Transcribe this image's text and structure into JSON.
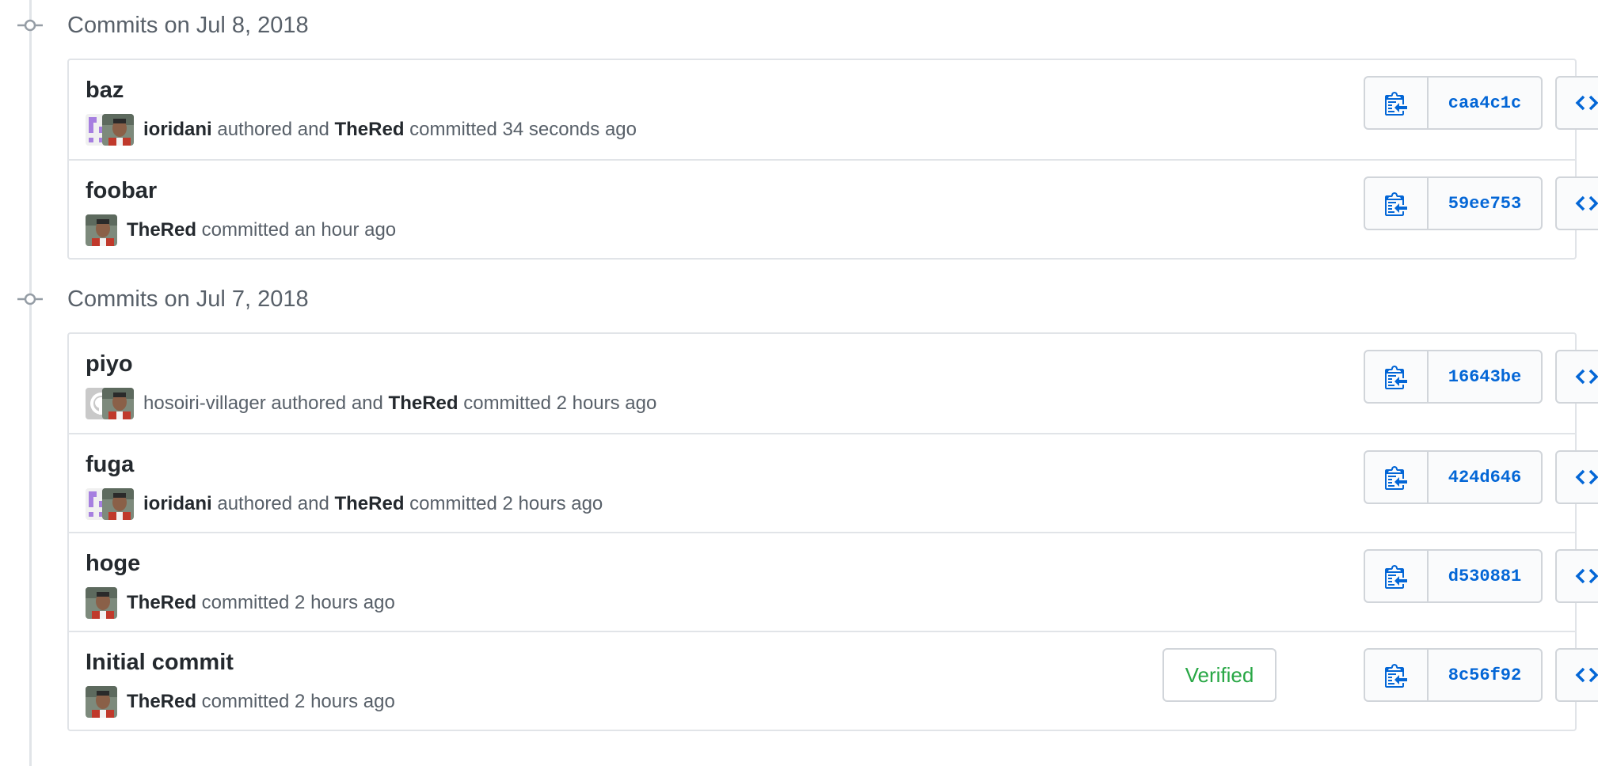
{
  "colors": {
    "accent": "#0366d6",
    "verified": "#28a745",
    "muted": "#586069",
    "border": "#e1e4e8"
  },
  "groups": [
    {
      "title": "Commits on Jul 8, 2018",
      "commits": [
        {
          "title": "baz",
          "author": "ioridani",
          "authored_text": " authored and ",
          "committer": "TheRed",
          "committed_text": " committed 34 seconds ago",
          "sha": "caa4c1c",
          "avatars": [
            "identicon-purple",
            "thered-photo"
          ]
        },
        {
          "title": "foobar",
          "committer": "TheRed",
          "committed_text": " committed an hour ago",
          "sha": "59ee753",
          "avatars": [
            "thered-photo"
          ]
        }
      ]
    },
    {
      "title": "Commits on Jul 7, 2018",
      "commits": [
        {
          "title": "piyo",
          "author": "hosoiri-villager",
          "authored_text": " authored and ",
          "committer": "TheRed",
          "committed_text": " committed 2 hours ago",
          "sha": "16643be",
          "avatars": [
            "github-default",
            "thered-photo"
          ]
        },
        {
          "title": "fuga",
          "author": "ioridani",
          "authored_text": " authored and ",
          "committer": "TheRed",
          "committed_text": " committed 2 hours ago",
          "sha": "424d646",
          "avatars": [
            "identicon-purple",
            "thered-photo"
          ]
        },
        {
          "title": "hoge",
          "committer": "TheRed",
          "committed_text": " committed 2 hours ago",
          "sha": "d530881",
          "avatars": [
            "thered-photo"
          ]
        },
        {
          "title": "Initial commit",
          "committer": "TheRed",
          "committed_text": " committed 2 hours ago",
          "sha": "8c56f92",
          "verified": "Verified",
          "avatars": [
            "thered-photo"
          ]
        }
      ]
    }
  ]
}
